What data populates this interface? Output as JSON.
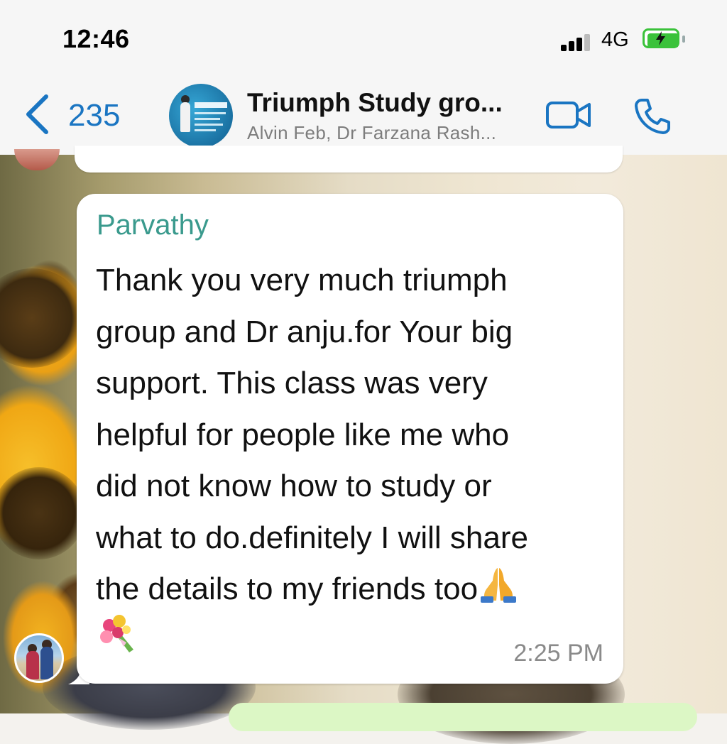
{
  "status_bar": {
    "time": "12:46",
    "network": "4G",
    "battery_state": "charging",
    "battery_color": "#3ac23a"
  },
  "header": {
    "back_count": "235",
    "title": "Triumph Study gro...",
    "subtitle": "Alvin Feb, Dr Farzana Rash...",
    "accent_color": "#1a75c2",
    "icons": [
      "chevron-left-icon",
      "video-camera-icon",
      "phone-icon"
    ]
  },
  "message": {
    "sender": "Parvathy",
    "lines": [
      "Thank you very much triumph",
      "group and Dr anju.for  Your big",
      "support. This class was very",
      "helpful for people like me who",
      "did not know how to study or",
      "what to do.definitely I will share",
      "the details to my friends too"
    ],
    "emoji_end": "praying-hands-icon",
    "emoji_line2": "bouquet-icon",
    "time": "2:25 PM",
    "sender_color": "#3a9a8d"
  }
}
